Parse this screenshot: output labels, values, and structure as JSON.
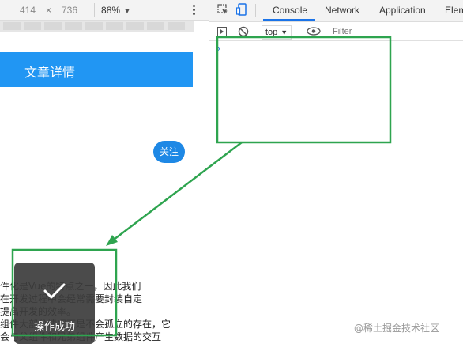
{
  "device_toolbar": {
    "width": "414",
    "times": "×",
    "height": "736",
    "zoom": "88%",
    "zoom_caret": "▼"
  },
  "app": {
    "header_title": "文章详情",
    "follow_label": "关注",
    "article_lines": [
      "件化是Vue的特点之一，因此我们",
      "在开发过程中会经常需要封装自定",
      "提高开发的效率。",
      "组件大部分情况下是不会孤立的存在，它",
      "会与父组件和兄弟组件产生数据的交互"
    ],
    "toast_text": "操作成功"
  },
  "devtools": {
    "tabs": {
      "console": "Console",
      "network": "Network",
      "application": "Application",
      "elements": "Elem"
    },
    "context": "top",
    "context_caret": "▼",
    "filter_placeholder": "Filter",
    "prompt": "›"
  },
  "watermark": "@稀土掘金技术社区",
  "colors": {
    "header": "#2196f3",
    "follow_button": "#1e88e5",
    "annotation": "#2ea44f",
    "tab_active": "#1a73e8"
  },
  "icons": [
    "more-vertical-icon",
    "inspect-element-icon",
    "device-toggle-icon",
    "sidebar-toggle-icon",
    "clear-console-icon",
    "eye-icon",
    "check-icon"
  ]
}
